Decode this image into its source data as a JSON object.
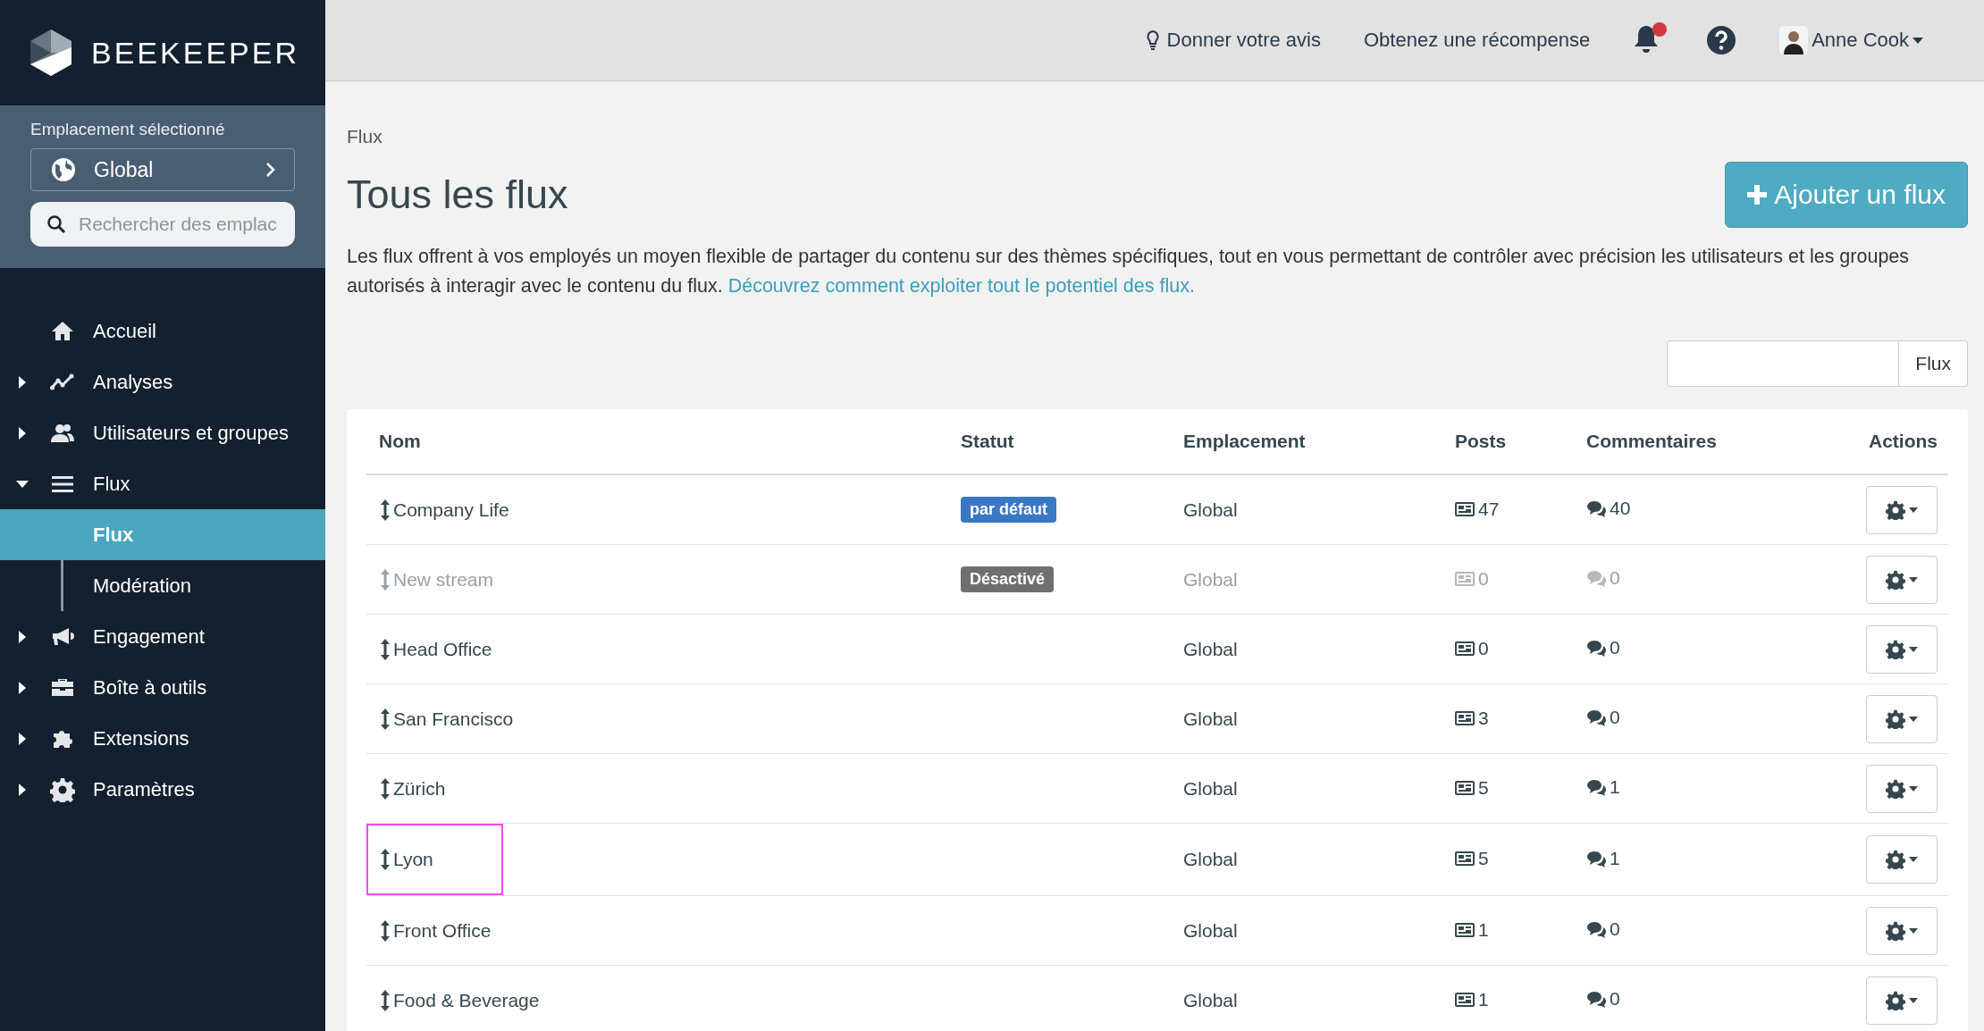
{
  "brand": {
    "name": "BEEKEEPER"
  },
  "location": {
    "label": "Emplacement sélectionné",
    "value": "Global",
    "search_placeholder": "Rechercher des emplac"
  },
  "sidebar": {
    "items": [
      {
        "label": "Accueil",
        "selected": false
      },
      {
        "label": "Analyses",
        "selected": false,
        "expanded": false
      },
      {
        "label": "Utilisateurs et groupes",
        "selected": false,
        "expanded": false
      },
      {
        "label": "Flux",
        "selected": false,
        "expanded": true,
        "children": [
          {
            "label": "Flux",
            "selected": true
          },
          {
            "label": "Modération",
            "selected": false
          }
        ]
      },
      {
        "label": "Engagement",
        "selected": false,
        "expanded": false
      },
      {
        "label": "Boîte à outils",
        "selected": false,
        "expanded": false
      },
      {
        "label": "Extensions",
        "selected": false,
        "expanded": false
      },
      {
        "label": "Paramètres",
        "selected": false,
        "expanded": false
      }
    ]
  },
  "topbar": {
    "feedback": "Donner votre avis",
    "reward": "Obtenez une récompense",
    "notifications_unread": true,
    "user": "Anne Cook"
  },
  "breadcrumb": "Flux",
  "title": "Tous les flux",
  "add_button": "Ajouter un flux",
  "description": {
    "text": "Les flux offrent à vos employés un moyen flexible de partager du contenu sur des thèmes spécifiques, tout en vous permettant de contrôler avec précision les utilisateurs et les groupes autorisés à interagir avec le contenu du flux.",
    "link": "Découvrez comment exploiter tout le potentiel des flux."
  },
  "search": {
    "button": "Flux"
  },
  "table": {
    "columns": [
      "Nom",
      "Statut",
      "Emplacement",
      "Posts",
      "Commentaires",
      "Actions"
    ],
    "rows": [
      {
        "name": "Company Life",
        "status": {
          "kind": "default",
          "label": "par défaut"
        },
        "location": "Global",
        "posts": "47",
        "comments": "40",
        "disabled": false,
        "highlighted": false
      },
      {
        "name": "New stream",
        "status": {
          "kind": "disabled",
          "label": "Désactivé"
        },
        "location": "Global",
        "posts": "0",
        "comments": "0",
        "disabled": true,
        "highlighted": false
      },
      {
        "name": "Head Office",
        "location": "Global",
        "posts": "0",
        "comments": "0",
        "disabled": false,
        "highlighted": false
      },
      {
        "name": "San Francisco",
        "location": "Global",
        "posts": "3",
        "comments": "0",
        "disabled": false,
        "highlighted": false
      },
      {
        "name": "Zürich",
        "location": "Global",
        "posts": "5",
        "comments": "1",
        "disabled": false,
        "highlighted": false
      },
      {
        "name": "Lyon",
        "location": "Global",
        "posts": "5",
        "comments": "1",
        "disabled": false,
        "highlighted": true
      },
      {
        "name": "Front Office",
        "location": "Global",
        "posts": "1",
        "comments": "0",
        "disabled": false,
        "highlighted": false
      },
      {
        "name": "Food & Beverage",
        "location": "Global",
        "posts": "1",
        "comments": "0",
        "disabled": false,
        "highlighted": false
      }
    ]
  }
}
